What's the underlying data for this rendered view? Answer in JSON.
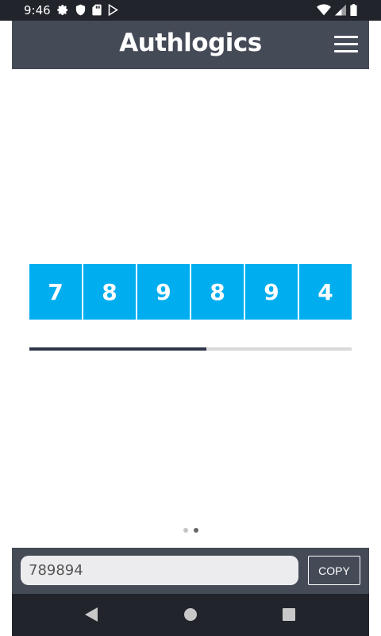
{
  "status_bar": {
    "time": "9:46",
    "left_icons": [
      "gear-icon",
      "shield-icon",
      "sd-card-icon",
      "play-store-icon"
    ],
    "right_icons": [
      "wifi-icon",
      "signal-icon",
      "battery-icon"
    ]
  },
  "header": {
    "logo_text": "Authlogics",
    "menu_icon": "hamburger-menu-icon"
  },
  "otp": {
    "digits": [
      "7",
      "8",
      "9",
      "8",
      "9",
      "4"
    ],
    "progress_fraction": 0.55
  },
  "pager": {
    "count": 2,
    "active_index": 1
  },
  "code_bar": {
    "code_value": "789894",
    "copy_label": "COPY"
  },
  "nav_bar": {
    "icons": [
      "back-icon",
      "home-icon",
      "recents-icon"
    ]
  },
  "colors": {
    "header_bg": "#454a57",
    "digit_bg": "#00aeef",
    "progress_fill": "#2f3548",
    "progress_track": "#d9d9d9",
    "system_bar": "#21242b"
  }
}
